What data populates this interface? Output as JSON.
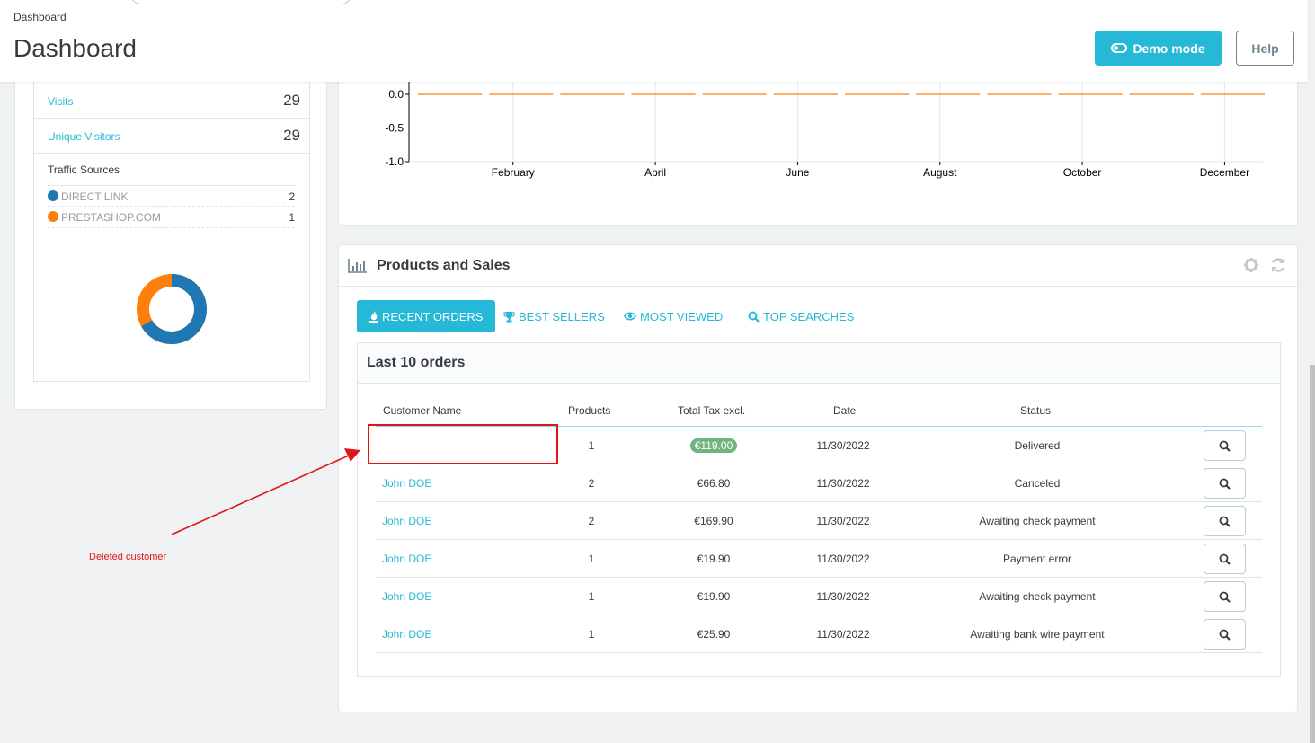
{
  "header": {
    "breadcrumb": "Dashboard",
    "title": "Dashboard",
    "demo_button": "Demo mode",
    "help_button": "Help"
  },
  "visitors": {
    "visits_label": "Visits",
    "visits_value": "29",
    "unique_label": "Unique Visitors",
    "unique_value": "29",
    "traffic_title": "Traffic Sources",
    "sources": [
      {
        "name": "DIRECT LINK",
        "count": "2",
        "color": "#1f77b4"
      },
      {
        "name": "PRESTASHOP.COM",
        "count": "1",
        "color": "#ff7f0e"
      }
    ]
  },
  "chart_data": {
    "type": "line",
    "x": [
      "February",
      "April",
      "June",
      "August",
      "October",
      "December"
    ],
    "y_ticks": [
      "0.0",
      "-0.5",
      "-1.0"
    ],
    "ylim": [
      -1.0,
      0.0
    ],
    "series": [
      {
        "values": [
          0,
          0,
          0,
          0,
          0,
          0,
          0,
          0,
          0,
          0,
          0,
          0
        ],
        "color": "#ff7f0e"
      }
    ]
  },
  "products_sales": {
    "title": "Products and Sales",
    "tabs": [
      {
        "label": "RECENT ORDERS",
        "active": true
      },
      {
        "label": "BEST SELLERS",
        "active": false
      },
      {
        "label": "MOST VIEWED",
        "active": false
      },
      {
        "label": "TOP SEARCHES",
        "active": false
      }
    ],
    "orders_title": "Last 10 orders",
    "columns": [
      "Customer Name",
      "Products",
      "Total Tax excl.",
      "Date",
      "Status"
    ],
    "rows": [
      {
        "customer": "",
        "products": "1",
        "total": "€119.00",
        "date": "11/30/2022",
        "status": "Delivered"
      },
      {
        "customer": "John DOE",
        "products": "2",
        "total": "€66.80",
        "date": "11/30/2022",
        "status": "Canceled"
      },
      {
        "customer": "John DOE",
        "products": "2",
        "total": "€169.90",
        "date": "11/30/2022",
        "status": "Awaiting check payment"
      },
      {
        "customer": "John DOE",
        "products": "1",
        "total": "€19.90",
        "date": "11/30/2022",
        "status": "Payment error"
      },
      {
        "customer": "John DOE",
        "products": "1",
        "total": "€19.90",
        "date": "11/30/2022",
        "status": "Awaiting check payment"
      },
      {
        "customer": "John DOE",
        "products": "1",
        "total": "€25.90",
        "date": "11/30/2022",
        "status": "Awaiting bank wire payment"
      }
    ]
  },
  "annotation": {
    "text": "Deleted customer"
  },
  "colors": {
    "accent": "#25b9d7",
    "badge_green": "#70b580",
    "annotation_red": "#e0151b"
  }
}
